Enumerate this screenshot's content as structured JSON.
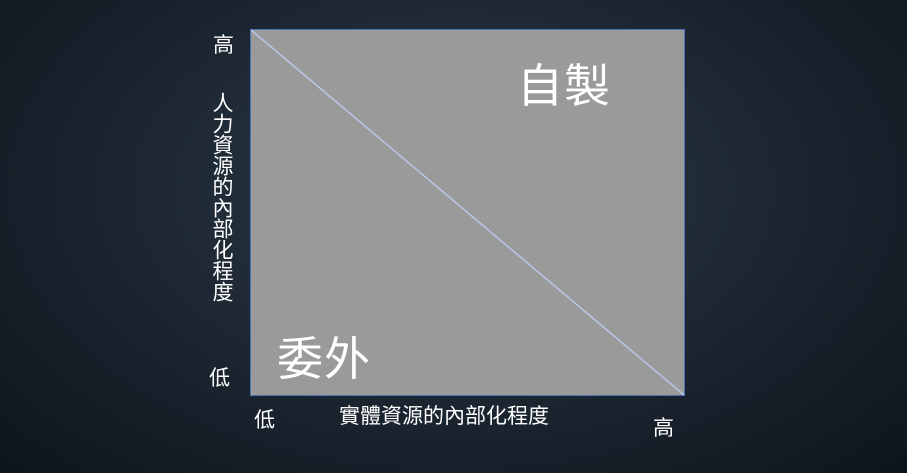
{
  "diagram": {
    "quadrants": {
      "upper_right": "自製",
      "lower_left": "委外"
    },
    "y_axis": {
      "title": "人力資源的內部化程度",
      "high": "高",
      "low": "低"
    },
    "x_axis": {
      "title": "實體資源的內部化程度",
      "low": "低",
      "high": "高"
    },
    "colors": {
      "background": "#1b2530",
      "matrix_fill": "#9a9a9a",
      "matrix_border": "#4a74b8",
      "diagonal": "#b8c8e6",
      "text": "#ffffff"
    }
  }
}
